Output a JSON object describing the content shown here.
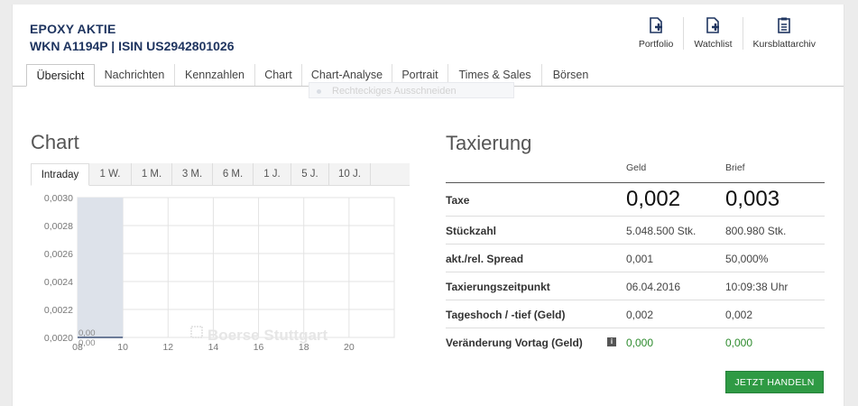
{
  "stock": {
    "name": "EPOXY AKTIE",
    "ids": "WKN A1194P | ISIN US2942801026"
  },
  "actions": [
    {
      "label": "Portfolio",
      "icon": "portfolio-add-icon"
    },
    {
      "label": "Watchlist",
      "icon": "watchlist-add-icon"
    },
    {
      "label": "Kursblattarchiv",
      "icon": "archive-icon"
    }
  ],
  "tabs": [
    "Übersicht",
    "Nachrichten",
    "Kennzahlen",
    "Chart",
    "Chart-Analyse",
    "Portrait",
    "Times & Sales",
    "Börsen"
  ],
  "active_tab": "Übersicht",
  "ghost_menu": "Rechteckiges Ausschneiden",
  "chart_section": {
    "title": "Chart",
    "tabs": [
      "Intraday",
      "1 W.",
      "1 M.",
      "3 M.",
      "6 M.",
      "1 J.",
      "5 J.",
      "10 J."
    ],
    "active_tab": "Intraday",
    "watermark": "Boerse Stuttgart"
  },
  "chart_data": {
    "type": "area",
    "x_ticks": [
      "08",
      "10",
      "12",
      "14",
      "16",
      "18",
      "20"
    ],
    "y_ticks": [
      "0,0030",
      "0,0028",
      "0,0026",
      "0,0024",
      "0,0022",
      "0,0020"
    ],
    "ylim": [
      0.002,
      0.003
    ],
    "xlim": [
      8,
      22
    ],
    "series": [
      {
        "x": [
          8,
          10
        ],
        "y": [
          0.002,
          0.002
        ]
      }
    ],
    "shaded_range": [
      8,
      10
    ],
    "annotations": [
      "0,00",
      "0,00"
    ],
    "grid": true
  },
  "taxierung": {
    "title": "Taxierung",
    "col_geld": "Geld",
    "col_brief": "Brief",
    "rows": [
      {
        "label": "Taxe",
        "geld": "0,002",
        "brief": "0,003",
        "style": "big"
      },
      {
        "label": "Stückzahl",
        "geld": "5.048.500 Stk.",
        "brief": "800.980 Stk.",
        "style": "normal"
      },
      {
        "label": "akt./rel. Spread",
        "geld": "0,001",
        "brief": "50,000%",
        "style": "normal"
      },
      {
        "label": "Taxierungszeitpunkt",
        "geld": "06.04.2016",
        "brief": "10:09:38 Uhr",
        "style": "normal"
      },
      {
        "label": "Tageshoch / -tief (Geld)",
        "geld": "0,002",
        "brief": "0,002",
        "style": "normal"
      },
      {
        "label": "Veränderung Vortag (Geld)",
        "geld": "0,000",
        "brief": "0,000",
        "style": "green",
        "info": "i"
      }
    ]
  },
  "trade_button": "JETZT HANDELN",
  "colors": {
    "brand_blue": "#1f3560",
    "trade_green": "#2f9a44",
    "positive": "#2c8a2c"
  }
}
